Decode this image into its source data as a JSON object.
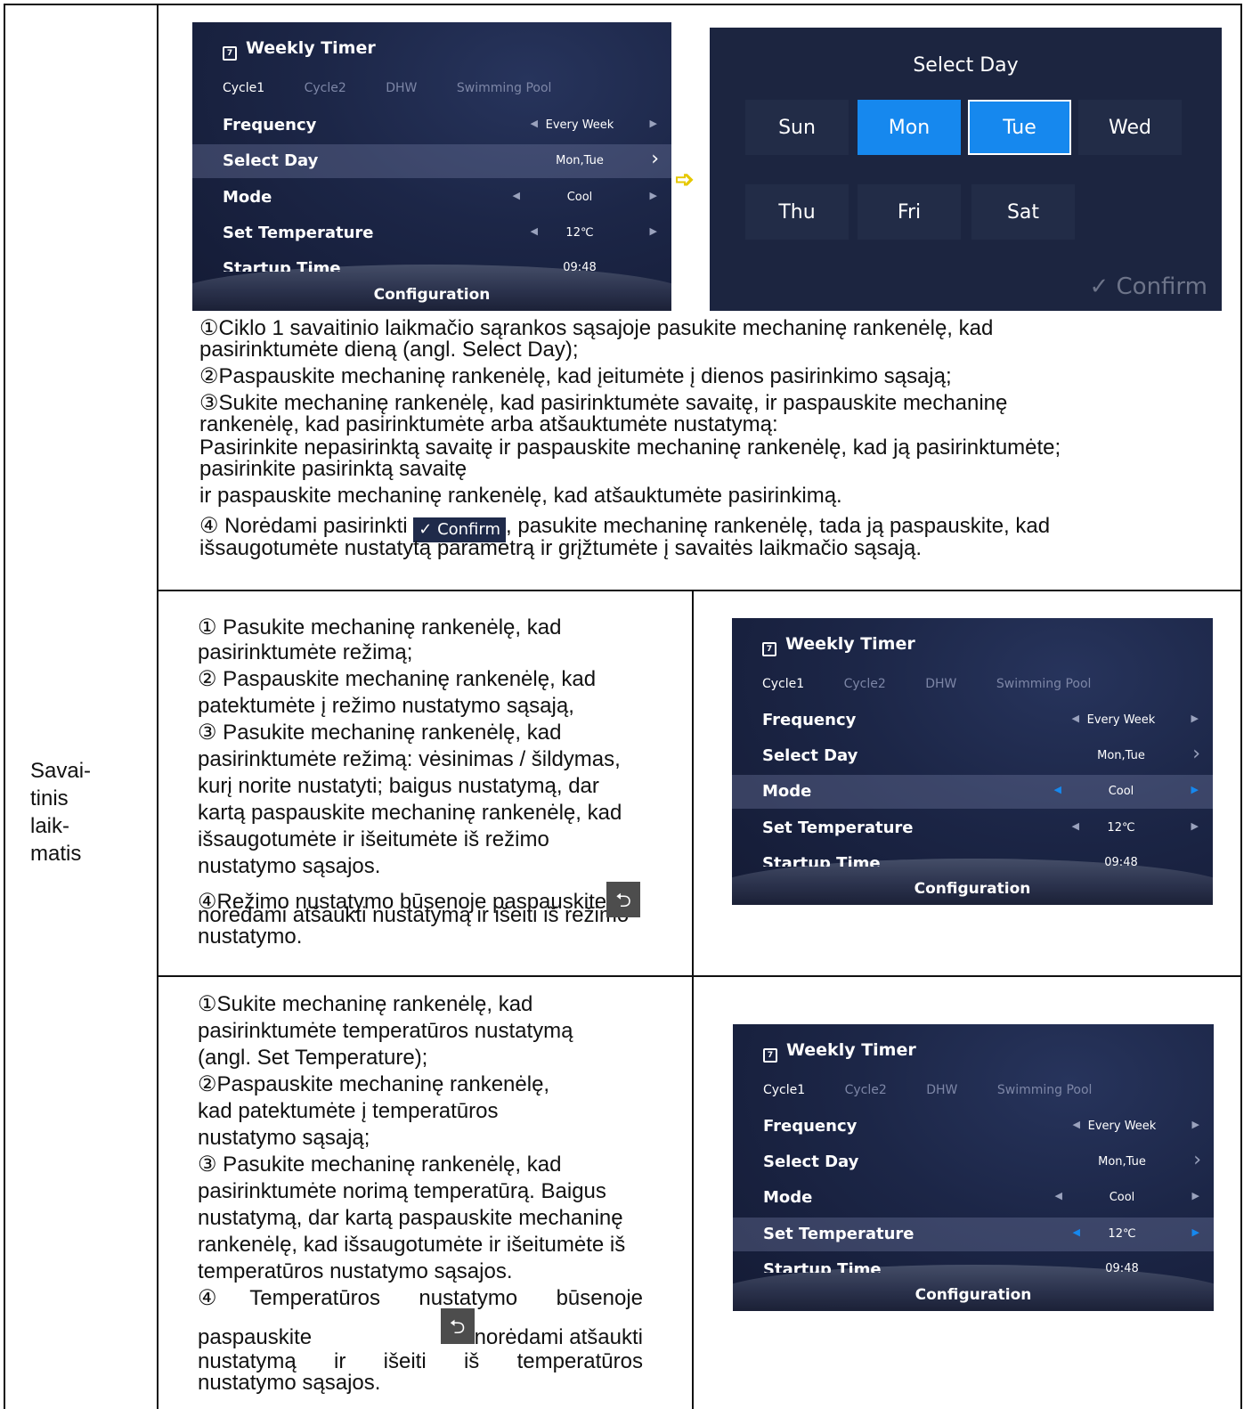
{
  "side_label": [
    "Savai-",
    "tinis",
    "laik-",
    "matis"
  ],
  "screen": {
    "title": "Weekly Timer",
    "calendar_digit": "7",
    "tabs": [
      "Cycle1",
      "Cycle2",
      "DHW",
      "Swimming Pool"
    ],
    "rows": [
      {
        "label": "Frequency",
        "value": "Every Week"
      },
      {
        "label": "Select Day",
        "value": "Mon,Tue"
      },
      {
        "label": "Mode",
        "value": "Cool"
      },
      {
        "label": "Set Temperature",
        "value": "12℃"
      },
      {
        "label": "Startup Time",
        "value": "09:48"
      }
    ],
    "footer": "Configuration",
    "highlight_color": "#1688ee"
  },
  "select_day": {
    "title": "Select Day",
    "days": [
      "Sun",
      "Mon",
      "Tue",
      "Wed",
      "Thu",
      "Fri",
      "Sat"
    ],
    "selected": [
      "Mon",
      "Tue"
    ],
    "focused": "Tue",
    "confirm": "✓  Confirm"
  },
  "section1": {
    "lines": [
      "①Ciklo 1 savaitinio laikmačio sąrankos sąsajoje pasukite mechaninę rankenėlę, kad",
      "pasirinktumėte dieną (angl. Select Day);",
      "②Paspauskite mechaninę rankenėlę, kad įeitumėte į dienos pasirinkimo sąsają;",
      "③Sukite mechaninę rankenėlę, kad pasirinktumėte savaitę, ir paspauskite mechaninę",
      "rankenėlę, kad pasirinktumėte arba atšauktumėte nustatymą:",
      "Pasirinkite nepasirinktą savaitę ir paspauskite mechaninę rankenėlę, kad ją pasirinktumėte;",
      "pasirinkite pasirinktą savaitę",
      "ir paspauskite mechaninę rankenėlę, kad atšauktumėte pasirinkimą."
    ],
    "step4_before": "④ Norėdami pasirinkti ",
    "step4_confirm": "✓ Confirm",
    "step4_after": ", pasukite mechaninę rankenėlę, tada ją paspauskite, kad",
    "step4_line2": "išsaugotumėte nustatytą parametrą ir grįžtumėte į savaitės laikmačio sąsają."
  },
  "section2": {
    "lines": [
      "① Pasukite mechaninę rankenėlę, kad",
      "pasirinktumėte režimą;",
      "② Paspauskite mechaninę rankenėlę, kad",
      "patektumėte į režimo nustatymo sąsają,",
      "③ Pasukite mechaninę rankenėlę, kad",
      "pasirinktumėte režimą: vėsinimas / šildymas,",
      "kurį norite nustatyti; baigus nustatymą, dar",
      "kartą paspauskite mechaninę rankenėlę, kad",
      "išsaugotumėte ir išeitumėte iš režimo",
      "nustatymo sąsajos."
    ],
    "step4_before": "④Režimo nustatymo būsenoje paspauskite",
    "step4_line2": "norėdami atšaukti nustatymą ir išeiti iš režimo",
    "step4_line3": "nustatymo."
  },
  "section3": {
    "lines": [
      "①Sukite mechaninę rankenėlę, kad",
      "pasirinktumėte temperatūros nustatymą",
      "(angl. Set Temperature);",
      "②Paspauskite mechaninę rankenėlę,",
      "kad patektumėte į temperatūros",
      "nustatymo sąsają;",
      "③ Pasukite mechaninę rankenėlę, kad",
      "pasirinktumėte norimą temperatūrą. Baigus",
      "nustatymą, dar kartą paspauskite mechaninę",
      "rankenėlę, kad išsaugotumėte ir išeitumėte iš",
      "temperatūros nustatymo sąsajos."
    ],
    "step4_line1": "④Temperatūros nustatymo būsenoje",
    "step4_press": "paspauskite",
    "step4_after": "norėdami atšaukti",
    "step4_line3": "nustatymą ir išeiti iš temperatūros",
    "step4_line4": "nustatymo sąsajos."
  }
}
